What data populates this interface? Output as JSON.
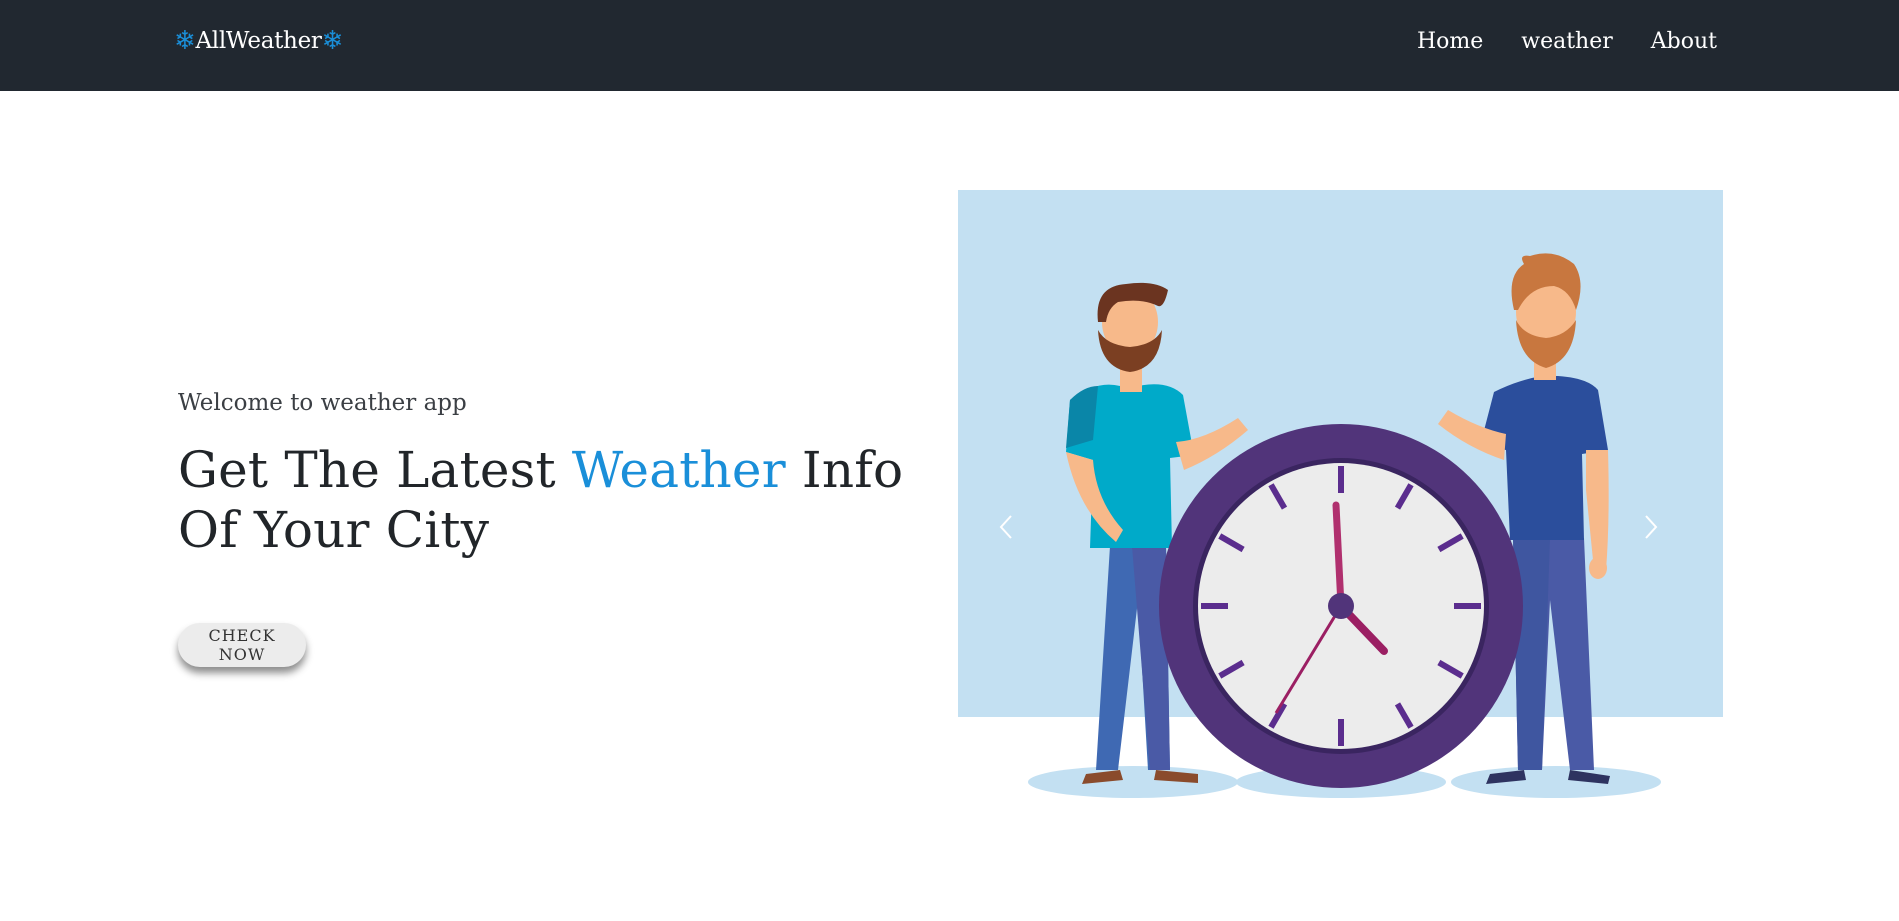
{
  "navbar": {
    "brand_text": "AllWeather",
    "brand_icon": "snowflake-icon",
    "links": [
      "Home",
      "weather",
      "About"
    ]
  },
  "hero": {
    "welcome": "Welcome to weather app",
    "headline_before": "Get The Latest ",
    "headline_accent": "Weather",
    "headline_after": " Info Of Your City",
    "button_label": "CHECK NOW"
  },
  "carousel": {
    "illustration": "two-men-with-clock",
    "prev_icon": "chevron-left-icon",
    "next_icon": "chevron-right-icon"
  },
  "colors": {
    "navbar_bg": "#212830",
    "accent": "#1a8fd9",
    "illustration_bg": "#c3e0f2",
    "clock_rim": "#51347a"
  }
}
